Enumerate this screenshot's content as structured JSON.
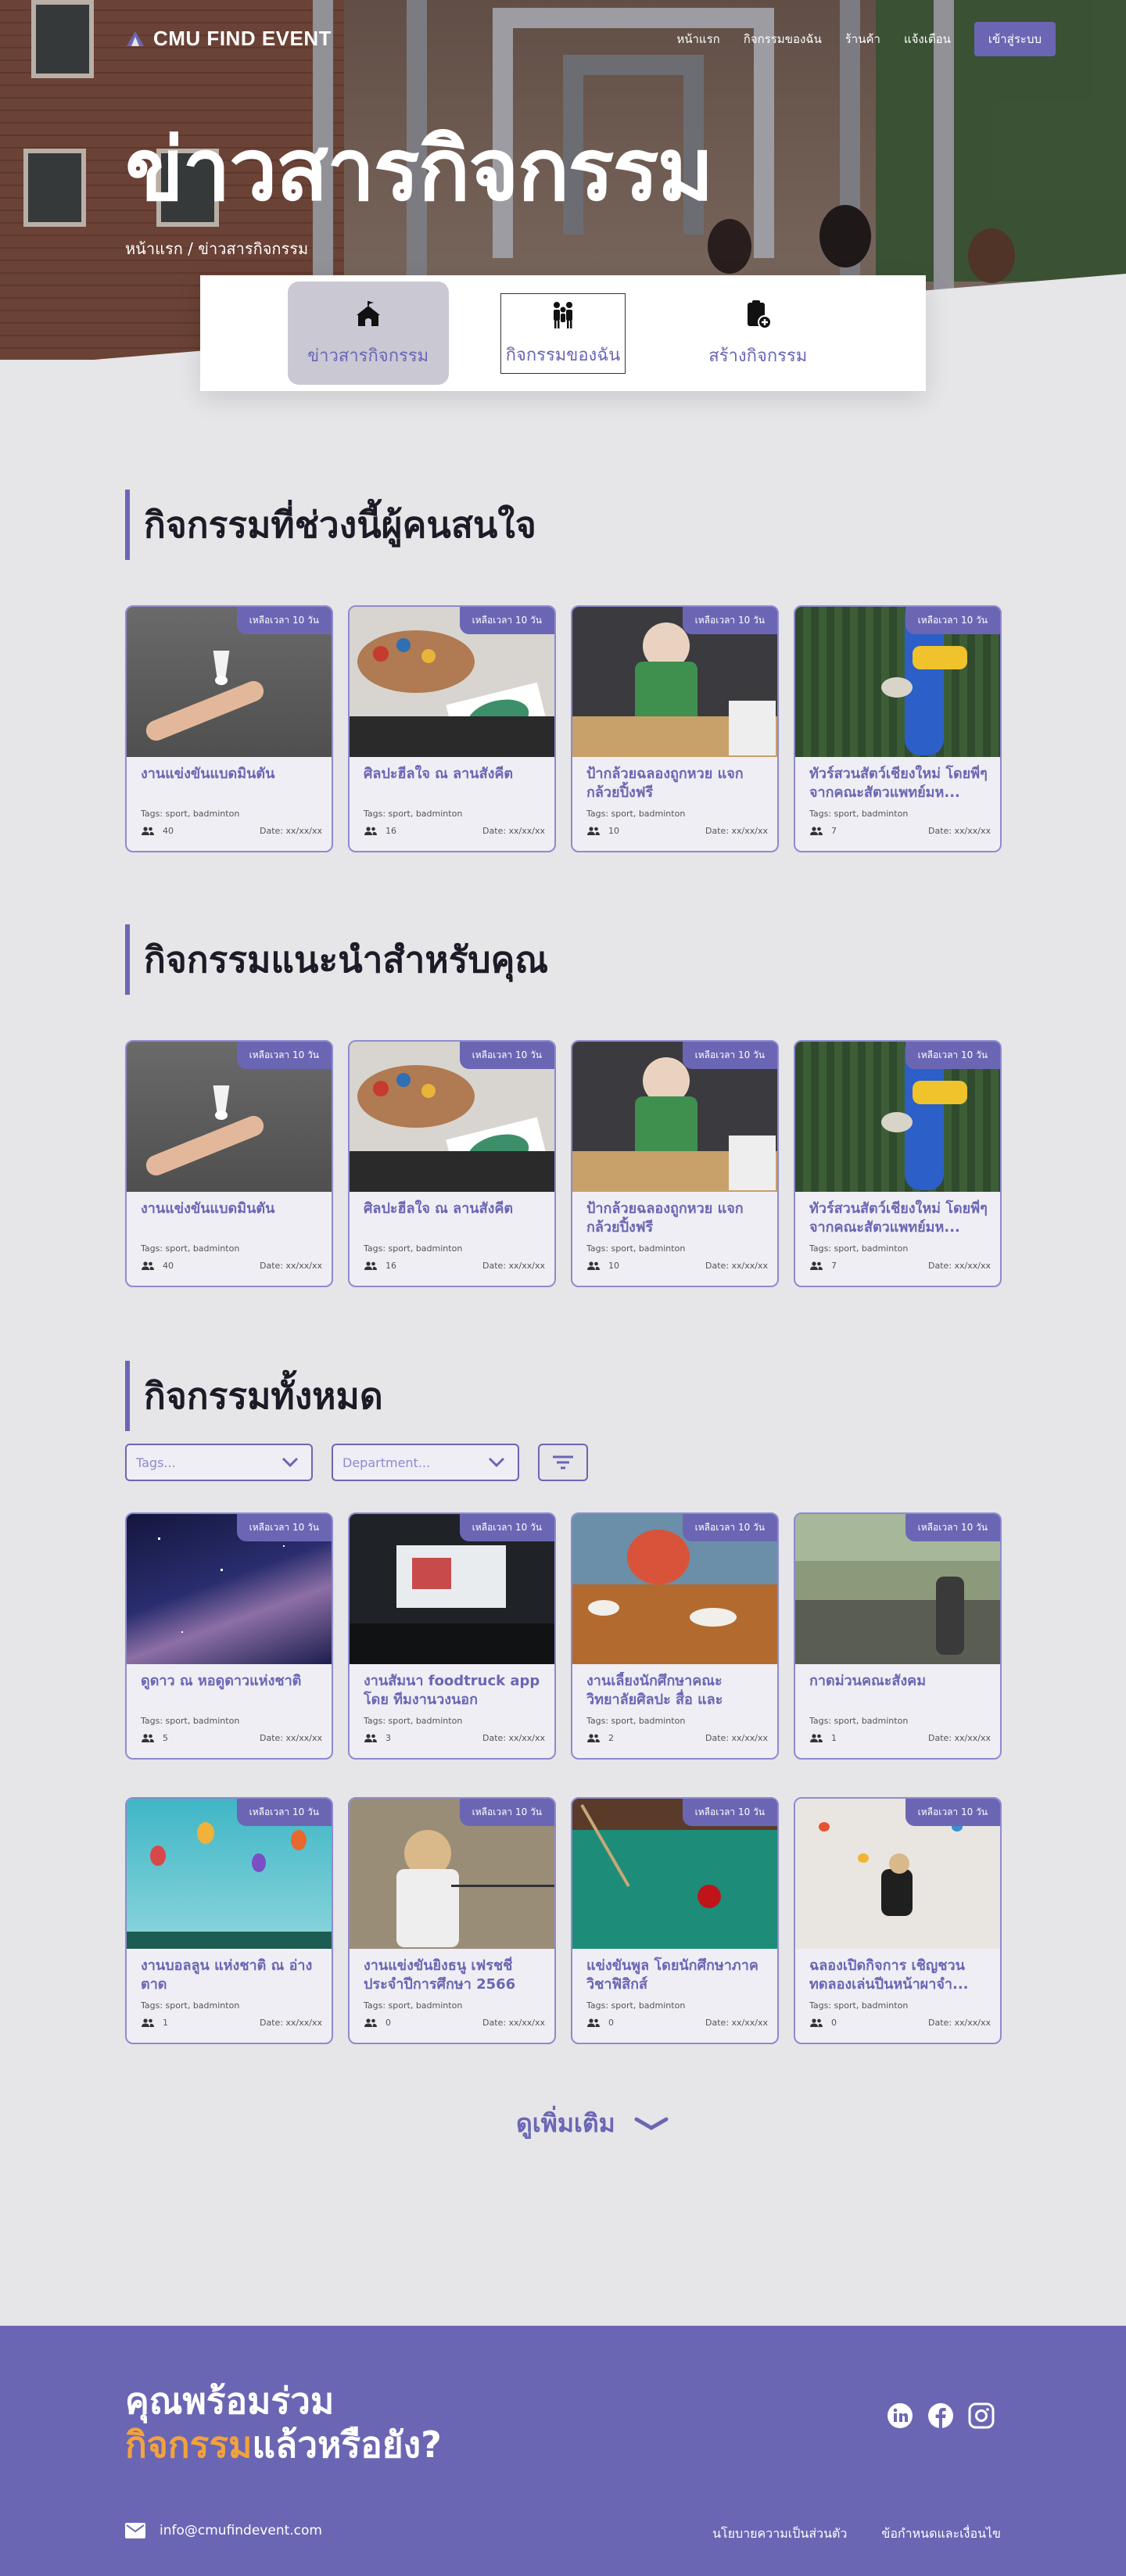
{
  "brand": {
    "name": "CMU FIND EVENT"
  },
  "nav": {
    "links": [
      "หน้าแรก",
      "กิจกรรมของฉัน",
      "ร้านค้า",
      "แจ้งเตือน"
    ],
    "login": "เข้าสู่ระบบ"
  },
  "hero": {
    "title": "ข่าวสารกิจกรรม",
    "breadcrumb": "หน้าแรก / ข่าวสารกิจกรรม"
  },
  "tabs": [
    {
      "label": "ข่าวสารกิจกรรม",
      "icon": "circus-tent-icon",
      "active": true
    },
    {
      "label": "กิจกรรมของฉัน",
      "icon": "group-people-icon",
      "active": false
    },
    {
      "label": "สร้างกิจกรรม",
      "icon": "clipboard-add-icon",
      "active": false
    }
  ],
  "sections": {
    "popular": "กิจกรรมที่ช่วงนี้ผู้คนสนใจ",
    "recommended": "กิจกรรมแนะนำสำหรับคุณ",
    "all": "กิจกรรมทั้งหมด"
  },
  "badge": "เหลือเวลา 10 วัน",
  "featured_cards": [
    {
      "title": "งานแข่งขันแบดมินตัน",
      "tags": "Tags: sport, badminton",
      "count": "40",
      "date": "Date: xx/xx/xx",
      "image": "badminton-shuttlecock"
    },
    {
      "title": "ศิลปะฮีลใจ ณ ลานสังคีต",
      "tags": "Tags: sport, badminton",
      "count": "16",
      "date": "Date: xx/xx/xx",
      "image": "painting-palette"
    },
    {
      "title": "ป้ากล้วยฉลองถูกหวย แจกกล้วยปิ้งฟรี",
      "tags": "Tags: sport, badminton",
      "count": "10",
      "date": "Date: xx/xx/xx",
      "image": "street-food-vendor"
    },
    {
      "title": "ทัวร์สวนสัตว์เชียงใหม่ โดยพี่ๆจากคณะสัตวแพทย์มห...",
      "tags": "Tags: sport, badminton",
      "count": "7",
      "date": "Date: xx/xx/xx",
      "image": "blue-macaw"
    }
  ],
  "filters": {
    "tags_placeholder": "Tags...",
    "department_placeholder": "Department..."
  },
  "all_cards": [
    {
      "title": "ดูดาว ณ หอดูดาวแห่งชาติ",
      "tags": "Tags: sport, badminton",
      "count": "5",
      "date": "Date: xx/xx/xx",
      "image": "milky-way"
    },
    {
      "title": "งานสัมนา foodtruck app โดย ทีมงานวงนอก",
      "tags": "Tags: sport, badminton",
      "count": "3",
      "date": "Date: xx/xx/xx",
      "image": "seminar-projector"
    },
    {
      "title": "งานเลี้ยงนักศึกษาคณะวิทยาลัยศิลปะ สื่อ และเทคโนโลยี...",
      "tags": "Tags: sport, badminton",
      "count": "2",
      "date": "Date: xx/xx/xx",
      "image": "dinner-table"
    },
    {
      "title": "กาดม่วนคณะสังคม",
      "tags": "Tags: sport, badminton",
      "count": "1",
      "date": "Date: xx/xx/xx",
      "image": "outdoor-market"
    },
    {
      "title": "งานบอลลูน แห่งชาติ ณ อ่างตาด",
      "tags": "Tags: sport, badminton",
      "count": "1",
      "date": "Date: xx/xx/xx",
      "image": "hot-air-balloons"
    },
    {
      "title": "งานแข่งขันยิงธนู เฟรชชี่ประจำปีการศึกษา 2566",
      "tags": "Tags: sport, badminton",
      "count": "0",
      "date": "Date: xx/xx/xx",
      "image": "archery-girl"
    },
    {
      "title": "แข่งขันพูล โดยนักศึกษาภาควิชาฟิสิกส์",
      "tags": "Tags: sport, badminton",
      "count": "0",
      "date": "Date: xx/xx/xx",
      "image": "pool-table"
    },
    {
      "title": "ฉลองเปิดกิจการ เชิญชวนทดลองเล่นปีนหน้าผาจำ...",
      "tags": "Tags: sport, badminton",
      "count": "0",
      "date": "Date: xx/xx/xx",
      "image": "climbing-wall"
    }
  ],
  "more": "ดูเพิ่มเติม",
  "footer": {
    "cta_line1": "คุณพร้อมร่วม",
    "cta_highlight": "กิจกรรม",
    "cta_rest": "แล้วหรือยัง?",
    "email": "info@cmufindevent.com",
    "links": [
      "นโยบายความเป็นส่วนตัว",
      "ข้อกำหนดและเงื่อนไข"
    ],
    "socials": [
      "linkedin-icon",
      "facebook-icon",
      "instagram-icon"
    ]
  },
  "colors": {
    "accent": "#6b66b4",
    "highlight": "#f2a23c",
    "background": "#e6e5e8"
  }
}
